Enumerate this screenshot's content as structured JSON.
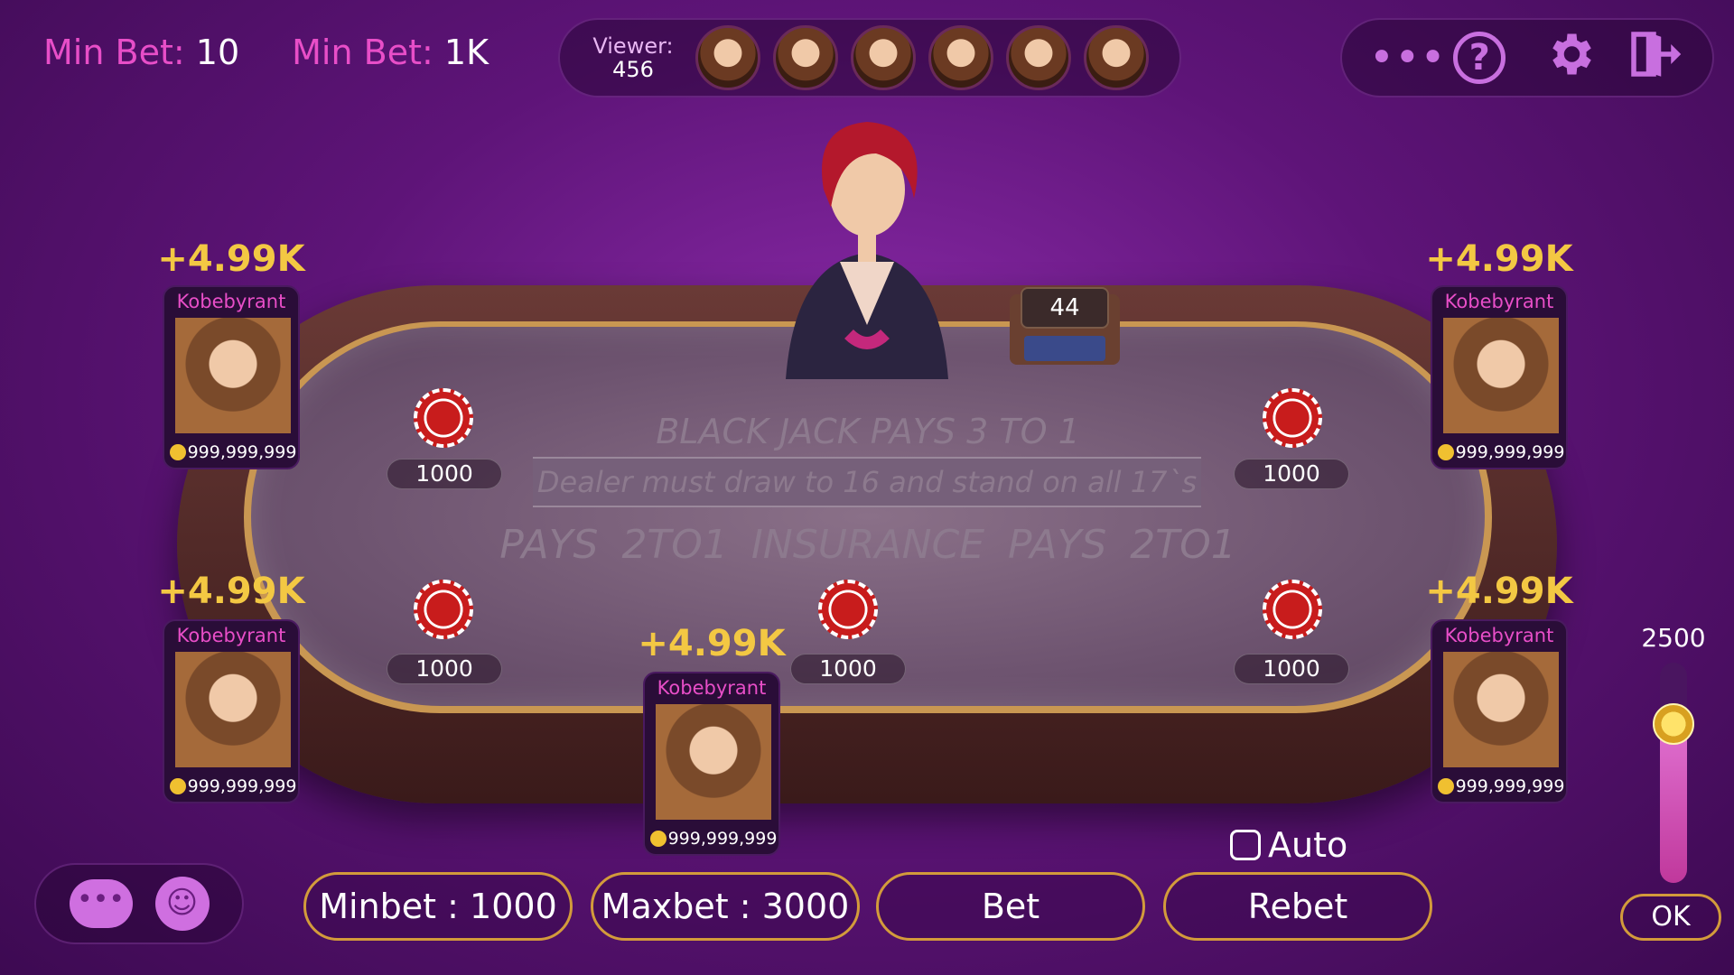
{
  "header": {
    "min_bet_1_label": "Min Bet:",
    "min_bet_1_value": "10",
    "min_bet_2_label": "Min Bet:",
    "min_bet_2_value": "1K",
    "viewer_label": "Viewer:",
    "viewer_count": "456",
    "viewer_avatar_count": 6
  },
  "tools": [
    "more-icon",
    "help-icon",
    "gear-icon",
    "exit-icon"
  ],
  "table": {
    "line1": "BLACK JACK PAYS 3 TO 1",
    "line2": "Dealer must draw to 16 and stand on all 17`s",
    "line3": "PAYS 2TO1   INSURANCE   PAYS 2TO1",
    "shoe_count": "44"
  },
  "bets": [
    "1000",
    "1000",
    "1000",
    "1000",
    "1000",
    "1000"
  ],
  "players": [
    {
      "win": "+4.99K",
      "name": "Kobebyrant",
      "coins": "999,999,999"
    },
    {
      "win": "+4.99K",
      "name": "Kobebyrant",
      "coins": "999,999,999"
    },
    {
      "win": "+4.99K",
      "name": "Kobebyrant",
      "coins": "999,999,999"
    },
    {
      "win": "+4.99K",
      "name": "Kobebyrant",
      "coins": "999,999,999"
    },
    {
      "win": "+4.99K",
      "name": "Kobebyrant",
      "coins": "999,999,999"
    }
  ],
  "controls": {
    "minbet": "Minbet : 1000",
    "maxbet": "Maxbet : 3000",
    "bet": "Bet",
    "rebet": "Rebet",
    "auto": "Auto",
    "auto_checked": false,
    "slider_value": "2500",
    "slider_level": 0.72,
    "ok": "OK"
  },
  "colors": {
    "accent_pink": "#e84ec8",
    "win_gold": "#f3c843",
    "button_border": "#d39b3b"
  }
}
